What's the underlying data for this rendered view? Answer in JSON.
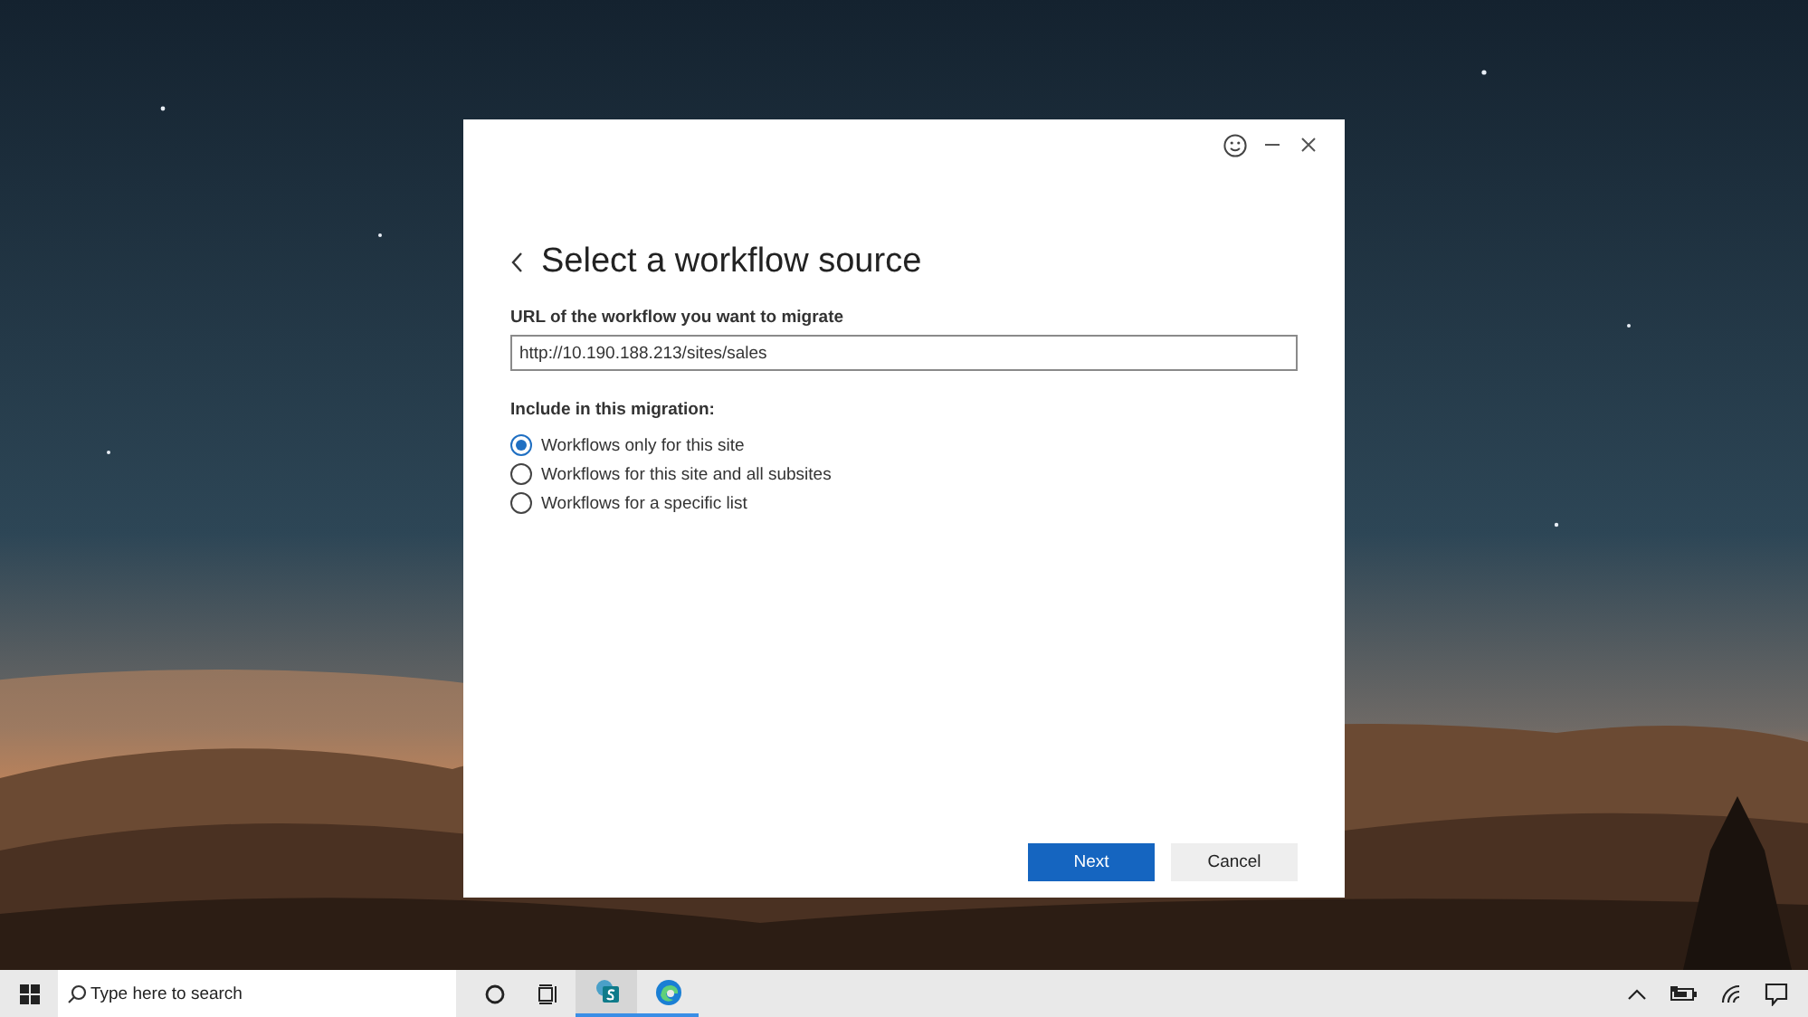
{
  "dialog": {
    "title": "Select a workflow source",
    "url_label": "URL of the workflow you want to migrate",
    "url_value": "http://10.190.188.213/sites/sales",
    "include_label": "Include in this migration:",
    "options": [
      {
        "label": "Workflows only for this site",
        "selected": true
      },
      {
        "label": "Workflows for this site and all subsites",
        "selected": false
      },
      {
        "label": "Workflows for a specific list",
        "selected": false
      }
    ],
    "buttons": [
      {
        "label": "Next",
        "kind": "primary"
      },
      {
        "label": "Cancel",
        "kind": "secondary"
      }
    ]
  },
  "taskbar": {
    "search": {
      "placeholder": "Type here to search"
    }
  }
}
